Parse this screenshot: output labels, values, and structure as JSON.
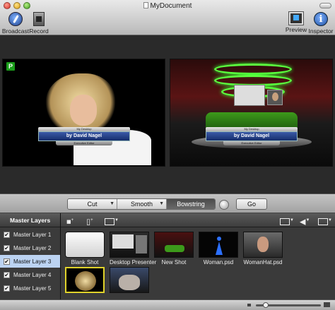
{
  "window": {
    "title": "MyDocument"
  },
  "toolbar": {
    "broadcast_label": "Broadcast",
    "record_label": "Record",
    "preview_label": "Preview",
    "inspector_label": "Inspector",
    "inspector_glyph": "i"
  },
  "monitors": {
    "live": {
      "badge": "P",
      "lower_third": {
        "top": "My Desktop",
        "main": "by David Nagel",
        "sub": "Executive Editor"
      }
    },
    "preview": {
      "lower_third": {
        "top": "My Desktop",
        "main": "by David Nagel",
        "sub": "Executive Editor"
      }
    }
  },
  "transitions": {
    "options": [
      "Cut",
      "Smooth",
      "Bowstring"
    ],
    "selected": "Bowstring",
    "go_label": "Go"
  },
  "layers": {
    "header": "Master Layers",
    "items": [
      {
        "label": "Master Layer 1",
        "checked": true,
        "active": false
      },
      {
        "label": "Master Layer 2",
        "checked": true,
        "active": false
      },
      {
        "label": "Master Layer 3",
        "checked": true,
        "active": true
      },
      {
        "label": "Master Layer 4",
        "checked": true,
        "active": false
      },
      {
        "label": "Master Layer 5",
        "checked": true,
        "active": false
      }
    ],
    "check_glyph": "✔"
  },
  "shots": {
    "items": [
      {
        "label": "Blank Shot"
      },
      {
        "label": "Desktop Presenter"
      },
      {
        "label": "New Shot"
      },
      {
        "label": "Woman.psd"
      },
      {
        "label": "WomanHat.psd"
      }
    ],
    "row2": [
      {
        "selected": true
      },
      {
        "selected": false
      }
    ]
  },
  "colors": {
    "accent_selected_layer": "#bcd3f2",
    "badge_green": "#1b9f1b",
    "selected_shot_border": "#e0d22a",
    "figure_blue": "#2c70ff"
  }
}
